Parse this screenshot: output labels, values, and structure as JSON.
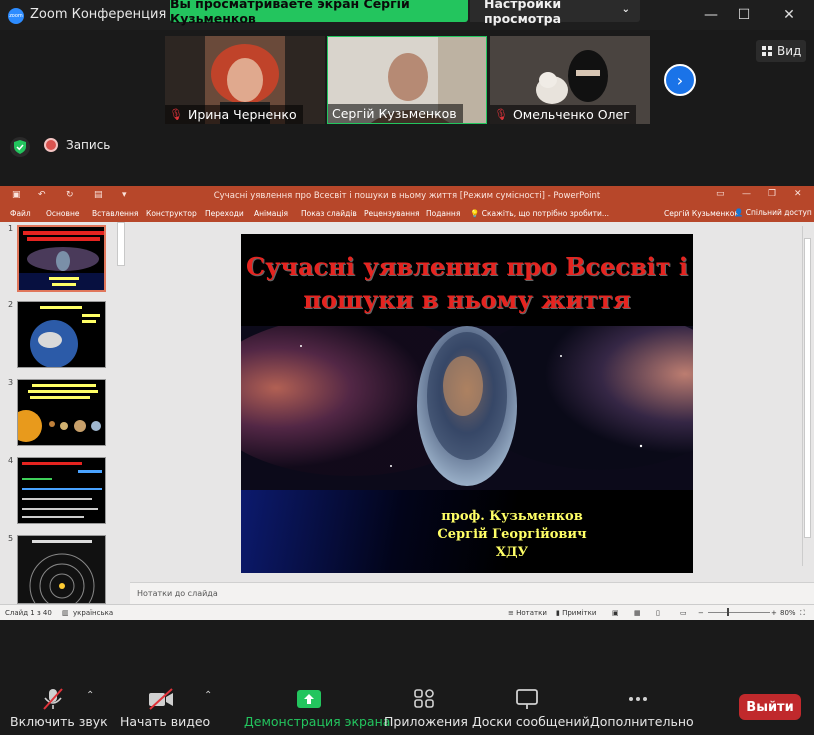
{
  "window": {
    "title": "Zoom Конференция",
    "logo_text": "zoom",
    "share_banner": "Вы просматриваете экран Сергій Кузьменков",
    "view_options": "Настройки просмотра"
  },
  "participants": [
    {
      "name": "Ирина Черненко",
      "muted": true
    },
    {
      "name": "Сергій Кузьменков",
      "muted": false,
      "active_speaker": true
    },
    {
      "name": "Омельченко Олег",
      "muted": true
    }
  ],
  "view_button": "Вид",
  "recording": "Запись",
  "powerpoint": {
    "title": "Сучасні уявлення про Всесвіт і пошуки в ньому життя [Режим сумісності] - PowerPoint",
    "tabs": [
      "Файл",
      "Основне",
      "Вставлення",
      "Конструктор",
      "Переходи",
      "Анімація",
      "Показ слайдів",
      "Рецензування",
      "Подання"
    ],
    "search": "Скажіть, що потрібно зробити...",
    "user": "Сергій Кузьменков",
    "share": "Спільний доступ",
    "thumbnail_numbers": [
      "1",
      "2",
      "3",
      "4",
      "5"
    ],
    "slide": {
      "title_line1": "Сучасні уявлення про Всесвіт і",
      "title_line2": "пошуки в ньому життя",
      "author_line1": "проф. Кузьменков",
      "author_line2": "Сергій Георгійович",
      "author_line3": "ХДУ"
    },
    "notes_placeholder": "Нотатки до слайда",
    "status": {
      "slide_counter": "Слайд 1 з 40",
      "language": "українська",
      "notes": "Нотатки",
      "comments": "Примітки",
      "zoom": "80%"
    }
  },
  "toolbar": {
    "mute": "Включить звук",
    "video": "Начать видео",
    "share": "Демонстрация экрана",
    "apps": "Приложения",
    "whiteboards": "Доски сообщений",
    "more": "Дополнительно",
    "leave": "Выйти"
  },
  "colors": {
    "share_banner": "#23c55e",
    "ppt_accent": "#b7472a",
    "leave": "#c0292c",
    "active_share": "#23c55e",
    "slide_title": "#e52420",
    "slide_author": "#ffff66"
  }
}
